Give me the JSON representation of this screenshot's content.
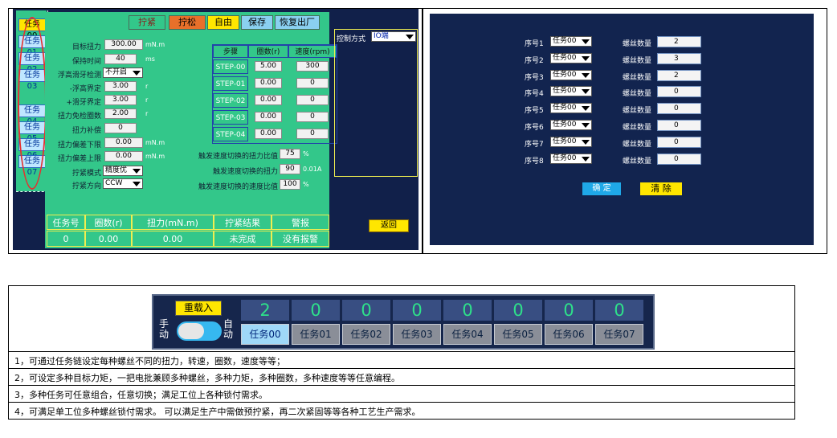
{
  "panel1": {
    "tasks_top": [
      "任务00",
      "任务01",
      "任务02",
      "任务03"
    ],
    "tasks_bottom": [
      "任务04",
      "任务05",
      "任务06",
      "任务07"
    ],
    "toolbar": [
      "拧紧",
      "拧松",
      "自由",
      "保存",
      "恢复出厂"
    ],
    "params": [
      {
        "label": "目标扭力",
        "value": "300.00",
        "unit": "mN.m"
      },
      {
        "label": "保持时间",
        "value": "40",
        "unit": "ms"
      },
      {
        "label": "浮高滑牙检测",
        "select": "不开启"
      },
      {
        "label": "-浮高界定",
        "value": "3.00",
        "unit": "r"
      },
      {
        "label": "+滑牙界定",
        "value": "3.00",
        "unit": "r"
      },
      {
        "label": "扭力免检圈数",
        "value": "2.00",
        "unit": "r"
      },
      {
        "label": "扭力补偿",
        "value": "0"
      },
      {
        "label": "扭力偏差下限",
        "value": "0.00",
        "unit": "mN.m"
      },
      {
        "label": "扭力偏差上限",
        "value": "0.00",
        "unit": "mN.m"
      },
      {
        "label": "拧紧模式",
        "select": "精度优"
      },
      {
        "label": "拧紧方向",
        "select": "CCW"
      }
    ],
    "steps_header": [
      "步骤",
      "圈数(r)",
      "速度(rpm)"
    ],
    "steps": [
      {
        "name": "STEP-00",
        "turns": "5.00",
        "speed": "300"
      },
      {
        "name": "STEP-01",
        "turns": "0.00",
        "speed": "0"
      },
      {
        "name": "STEP-02",
        "turns": "0.00",
        "speed": "0"
      },
      {
        "name": "STEP-03",
        "turns": "0.00",
        "speed": "0"
      },
      {
        "name": "STEP-04",
        "turns": "0.00",
        "speed": "0"
      }
    ],
    "switch": [
      {
        "label": "触发速度切换的扭力比值",
        "value": "75",
        "unit": "%"
      },
      {
        "label": "触发速度切换的扭力",
        "value": "90",
        "unit": "0.01A"
      },
      {
        "label": "触发速度切换的速度比值",
        "value": "100",
        "unit": "%"
      }
    ],
    "control_label": "控制方式",
    "control_value": "IO端",
    "result_header": [
      "任务号",
      "圈数(r)",
      "扭力(mN.m)",
      "拧紧结果",
      "警报"
    ],
    "result_values": [
      "0",
      "0.00",
      "0.00",
      "未完成",
      "没有报警"
    ],
    "back_label": "返回"
  },
  "panel2": {
    "rows": [
      {
        "seq": "序号1",
        "task": "任务00",
        "count": "2"
      },
      {
        "seq": "序号2",
        "task": "任务00",
        "count": "3"
      },
      {
        "seq": "序号3",
        "task": "任务00",
        "count": "2"
      },
      {
        "seq": "序号4",
        "task": "任务00",
        "count": "0"
      },
      {
        "seq": "序号5",
        "task": "任务00",
        "count": "0"
      },
      {
        "seq": "序号6",
        "task": "任务00",
        "count": "0"
      },
      {
        "seq": "序号7",
        "task": "任务00",
        "count": "0"
      },
      {
        "seq": "序号8",
        "task": "任务00",
        "count": "0"
      }
    ],
    "count_label": "螺丝数量",
    "confirm": "确 定",
    "clear": "清 除"
  },
  "panel3": {
    "reload": "重载入",
    "manual": "手\n动",
    "auto": "自\n动",
    "counts": [
      "2",
      "0",
      "0",
      "0",
      "0",
      "0",
      "0",
      "0"
    ],
    "tasks": [
      "任务00",
      "任务01",
      "任务02",
      "任务03",
      "任务04",
      "任务05",
      "任务06",
      "任务07"
    ]
  },
  "notes": [
    "1，可通过任务链设定每种螺丝不同的扭力，转速，圈数，速度等等；",
    "2，可设定多种目标力矩，一把电批兼顾多种螺丝，多种力矩，多种圈数，多种速度等等任意编程。",
    "3，多种任务可任意组合，任意切换；满足工位上各种锁付需求。",
    "4，可满足单工位多种螺丝锁付需求。 可以满足生产中需做预拧紧，再二次紧固等等各种工艺生产需求。"
  ],
  "colors": {
    "panel_bg": "#11204a",
    "green": "#33c78a",
    "highlight": "#ffe600",
    "digit": "#2ee08a"
  }
}
